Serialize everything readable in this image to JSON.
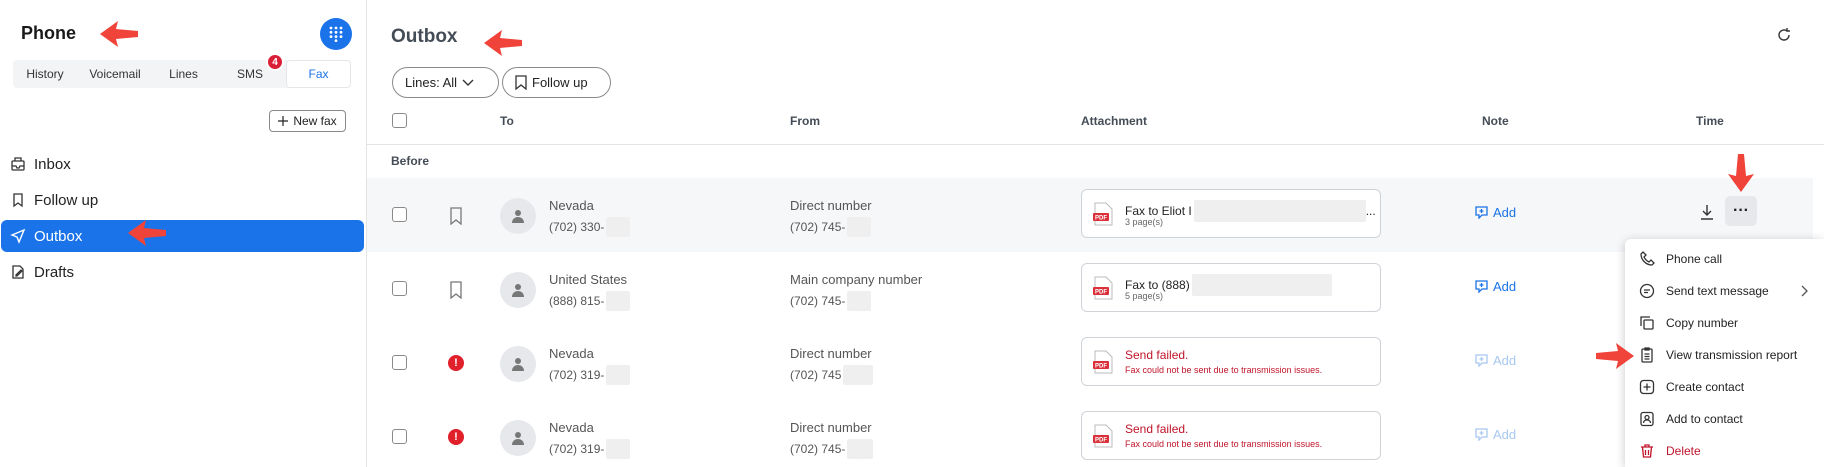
{
  "sidebar": {
    "title": "Phone",
    "tabs": [
      {
        "label": "History"
      },
      {
        "label": "Voicemail"
      },
      {
        "label": "Lines"
      },
      {
        "label": "SMS",
        "badge": "4"
      },
      {
        "label": "Fax",
        "active": true
      }
    ],
    "new_fax_label": "New fax",
    "nav": [
      {
        "label": "Inbox",
        "icon": "inbox-icon"
      },
      {
        "label": "Follow up",
        "icon": "bookmark-icon"
      },
      {
        "label": "Outbox",
        "icon": "send-icon",
        "active": true
      },
      {
        "label": "Drafts",
        "icon": "drafts-icon"
      }
    ]
  },
  "main": {
    "title": "Outbox",
    "filters": {
      "lines": "Lines: All",
      "follow_up": "Follow up"
    },
    "columns": {
      "to": "To",
      "from": "From",
      "attachment": "Attachment",
      "note": "Note",
      "time": "Time"
    },
    "group": "Before",
    "rows": [
      {
        "to_name": "Nevada",
        "to_number": "(702) 330-",
        "from_name": "Direct number",
        "from_number": "(702) 745-",
        "attachment_title": "Fax to Eliot I",
        "attachment_suffix": "...",
        "attachment_sub": "3 page(s)",
        "status": "ok",
        "note": "Add"
      },
      {
        "to_name": "United States",
        "to_number": "(888) 815-",
        "from_name": "Main company number",
        "from_number": "(702) 745-",
        "attachment_title": "Fax to (888)",
        "attachment_suffix": "",
        "attachment_sub": "5 page(s)",
        "status": "ok",
        "note": "Add"
      },
      {
        "to_name": "Nevada",
        "to_number": "(702) 319-",
        "from_name": "Direct number",
        "from_number": "(702) 745",
        "attachment_title": "Send failed.",
        "attachment_suffix": "",
        "attachment_sub": "Fax could not be sent due to transmission issues.",
        "status": "failed",
        "note": "Add"
      },
      {
        "to_name": "Nevada",
        "to_number": "(702) 319-",
        "from_name": "Direct number",
        "from_number": "(702) 745-",
        "attachment_title": "Send failed.",
        "attachment_suffix": "",
        "attachment_sub": "Fax could not be sent due to transmission issues.",
        "status": "failed",
        "note": "Add"
      }
    ]
  },
  "context_menu": {
    "items": [
      {
        "label": "Phone call",
        "icon": "phone-icon"
      },
      {
        "label": "Send text message",
        "icon": "chat-icon",
        "submenu": true
      },
      {
        "label": "Copy number",
        "icon": "copy-icon"
      },
      {
        "label": "View transmission report",
        "icon": "report-icon"
      },
      {
        "label": "Create contact",
        "icon": "plus-square-icon"
      },
      {
        "label": "Add to contact",
        "icon": "contact-icon"
      },
      {
        "label": "Delete",
        "icon": "trash-icon"
      }
    ]
  },
  "colors": {
    "accent": "#1a73e8",
    "danger": "#c0142a",
    "badge": "#d92038",
    "arrow": "#f0433a"
  }
}
